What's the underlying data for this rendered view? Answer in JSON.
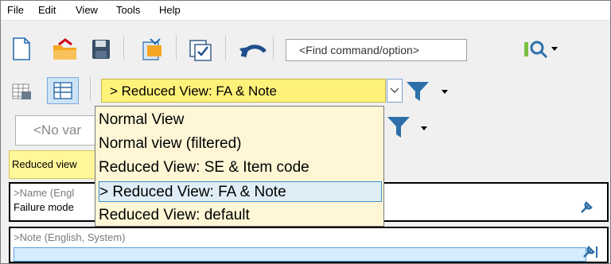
{
  "menu": {
    "items": [
      "File",
      "Edit",
      "View",
      "Tools",
      "Help"
    ]
  },
  "toolbar": {
    "find_placeholder": "<Find command/option>",
    "icons": [
      "new-document-icon",
      "open-folder-icon",
      "save-icon",
      "export-icon",
      "checklist-icon",
      "undo-icon",
      "search-options-icon"
    ]
  },
  "view_selector": {
    "selected": "> Reduced View: FA & Note",
    "options": [
      "Normal View",
      "Normal view (filtered)",
      "Reduced View: SE & Item code",
      "> Reduced View: FA & Note",
      "Reduced View: default"
    ],
    "highlighted_index": 3
  },
  "variants": {
    "placeholder": "<No var"
  },
  "tab": {
    "label": "Reduced view"
  },
  "fields": [
    {
      "label": ">Name (Engl",
      "value": "Failure mode"
    },
    {
      "label": ">Note (English, System)",
      "value": ""
    }
  ],
  "colors": {
    "selector_bg": "#fff27a",
    "dropdown_bg": "#fff6d6",
    "highlight_border": "#3b8ec9",
    "funnel": "#2d6fa8"
  }
}
